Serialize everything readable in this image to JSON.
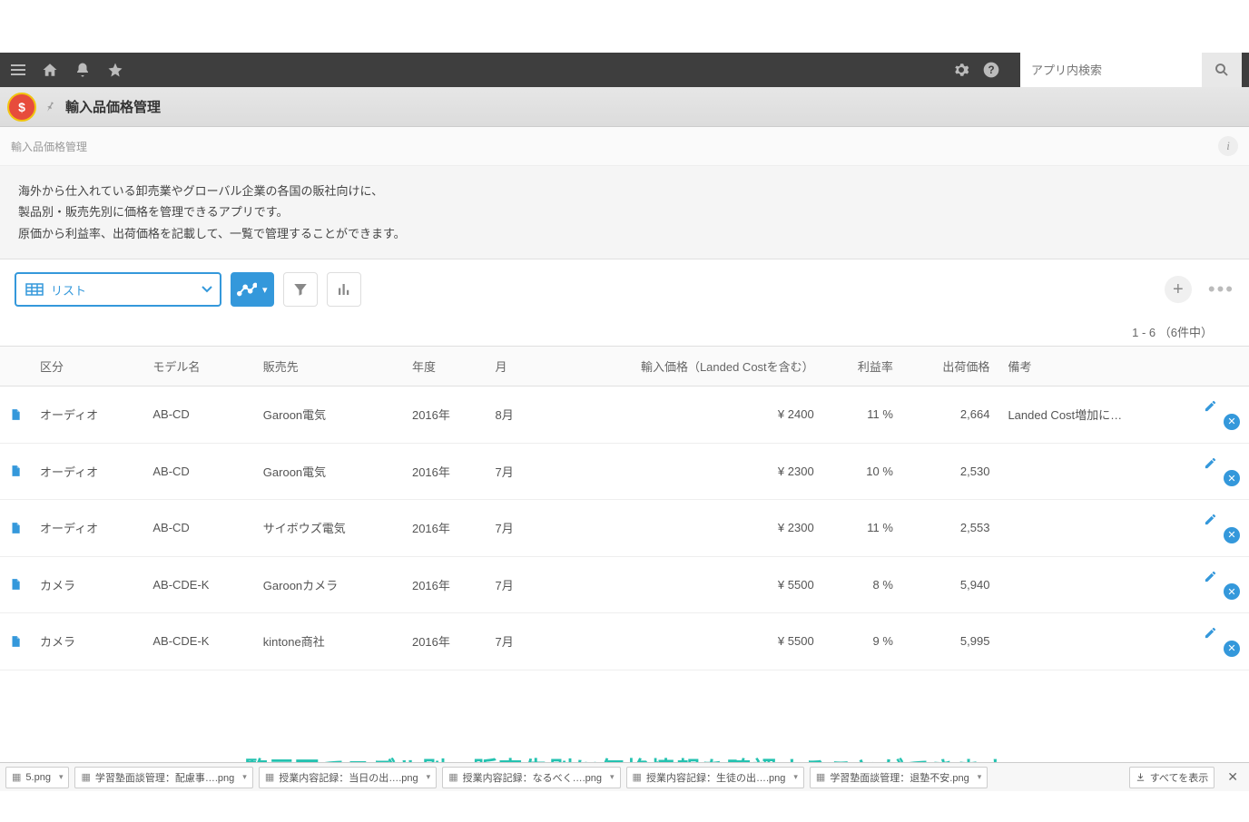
{
  "header": {
    "search_placeholder": "アプリ内検索",
    "app_title": "輸入品価格管理",
    "sub_title": "輸入品価格管理",
    "description_line1": "海外から仕入れている卸売業やグローバル企業の各国の販社向けに、",
    "description_line2": "製品別・販売先別に価格を管理できるアプリです。",
    "description_line3": "原価から利益率、出荷価格を記載して、一覧で管理することができます。"
  },
  "toolbar": {
    "view_label": "リスト",
    "pagination": "1 - 6 （6件中）"
  },
  "table": {
    "headers": {
      "category": "区分",
      "model": "モデル名",
      "customer": "販売先",
      "year": "年度",
      "month": "月",
      "import_price": "輸入価格（Landed Costを含む）",
      "margin": "利益率",
      "ship_price": "出荷価格",
      "remarks": "備考"
    },
    "rows": [
      {
        "category": "オーディオ",
        "model": "AB-CD",
        "customer": "Garoon電気",
        "year": "2016年",
        "month": "8月",
        "import_price": "¥ 2400",
        "margin": "11 %",
        "ship_price": "2,664",
        "remarks": "Landed Cost増加に…"
      },
      {
        "category": "オーディオ",
        "model": "AB-CD",
        "customer": "Garoon電気",
        "year": "2016年",
        "month": "7月",
        "import_price": "¥ 2300",
        "margin": "10 %",
        "ship_price": "2,530",
        "remarks": ""
      },
      {
        "category": "オーディオ",
        "model": "AB-CD",
        "customer": "サイボウズ電気",
        "year": "2016年",
        "month": "7月",
        "import_price": "¥ 2300",
        "margin": "11 %",
        "ship_price": "2,553",
        "remarks": ""
      },
      {
        "category": "カメラ",
        "model": "AB-CDE-K",
        "customer": "Garoonカメラ",
        "year": "2016年",
        "month": "7月",
        "import_price": "¥ 5500",
        "margin": "8 %",
        "ship_price": "5,940",
        "remarks": ""
      },
      {
        "category": "カメラ",
        "model": "AB-CDE-K",
        "customer": "kintone商社",
        "year": "2016年",
        "month": "7月",
        "import_price": "¥ 5500",
        "margin": "9 %",
        "ship_price": "5,995",
        "remarks": ""
      }
    ]
  },
  "downloads": {
    "items": [
      "5.png",
      "学習塾面談管理：配慮事….png",
      "授業内容記録：当日の出….png",
      "授業内容記録：なるべく….png",
      "授業内容記録：生徒の出….png",
      "学習塾面談管理：退塾不安.png"
    ],
    "show_all": "すべてを表示"
  },
  "caption": "一覧画面でモデル別、販売先別に価格情報を確認することができます。"
}
